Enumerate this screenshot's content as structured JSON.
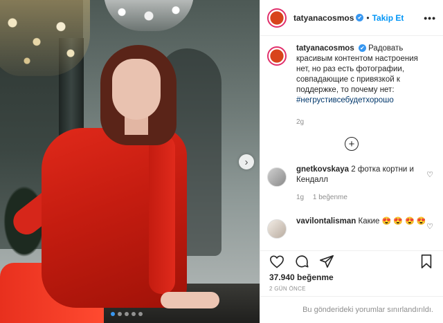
{
  "post_author": {
    "username": "tatyanacosmos",
    "separator": "•",
    "follow_label": "Takip Et",
    "more_label": "•••"
  },
  "caption": {
    "username": "tatyanacosmos",
    "text": "Радовать красивым контентом настроения нет, но раз есть фотографии, совпадающие с привязкой к поддержке, то почему нет:",
    "hashtag": "#негрустивсебудетхорошо",
    "age": "2g"
  },
  "load_more_label": "+",
  "comments": [
    {
      "username": "gnetkovskaya",
      "text": "2 фотка кортни и Кендалл",
      "age": "1g",
      "likes": "1 beğenme"
    },
    {
      "username": "vavilontalisman",
      "text": "Какие",
      "emojis": "😍 😍 😍 😍"
    }
  ],
  "icons": {
    "verified": "✔",
    "heart_small": "♡",
    "next": "›"
  },
  "carousel": {
    "total": 5,
    "current": 1
  },
  "likes_count": "37.940 beğenme",
  "post_date": "2 GÜN ÖNCE",
  "comments_limited": "Bu gönderideki yorumlar sınırlandırıldı."
}
